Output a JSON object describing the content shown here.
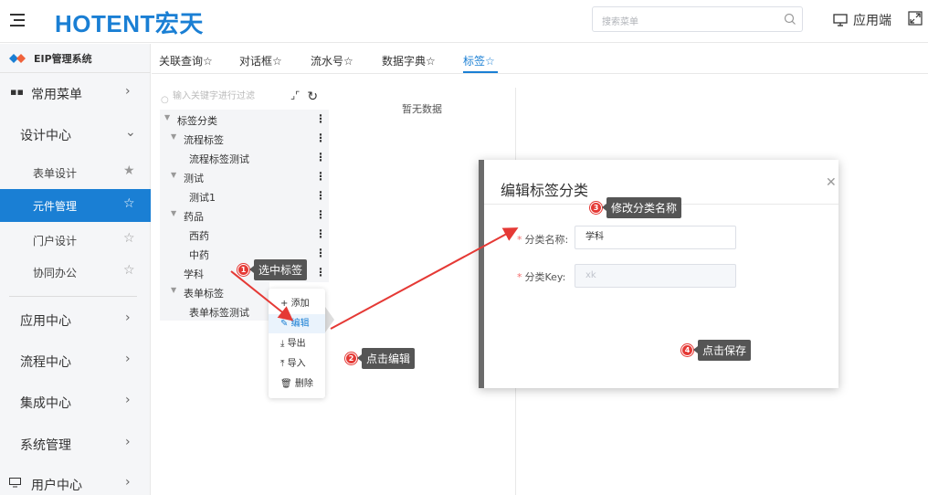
{
  "header": {
    "logo_text": "HOTENT宏天",
    "search_placeholder": "搜索菜单",
    "app_label": "应用端"
  },
  "sidebar": {
    "system_name": "EIP管理系统",
    "common_menu": "常用菜单",
    "design_center": "设计中心",
    "sub_items": [
      {
        "label": "表单设计",
        "active": false
      },
      {
        "label": "元件管理",
        "active": true
      },
      {
        "label": "门户设计",
        "active": false
      },
      {
        "label": "协同办公",
        "active": false
      }
    ],
    "groups": [
      "应用中心",
      "流程中心",
      "集成中心",
      "系统管理",
      "用户中心"
    ]
  },
  "tabs": [
    {
      "label": "关联查询☆",
      "active": false
    },
    {
      "label": "对话框☆",
      "active": false
    },
    {
      "label": "流水号☆",
      "active": false
    },
    {
      "label": "数据字典☆",
      "active": false
    },
    {
      "label": "标签☆",
      "active": true
    }
  ],
  "tree": {
    "filter_placeholder": "输入关键字进行过滤",
    "nodes": [
      {
        "label": "标签分类",
        "level": 0,
        "expanded": true
      },
      {
        "label": "流程标签",
        "level": 1,
        "expanded": true
      },
      {
        "label": "流程标签测试",
        "level": 2
      },
      {
        "label": "测试",
        "level": 1,
        "expanded": true
      },
      {
        "label": "测试1",
        "level": 2
      },
      {
        "label": "药品",
        "level": 1,
        "expanded": true
      },
      {
        "label": "西药",
        "level": 2
      },
      {
        "label": "中药",
        "level": 2
      },
      {
        "label": "学科",
        "level": 1
      },
      {
        "label": "表单标签",
        "level": 1,
        "expanded": true
      },
      {
        "label": "表单标签测试",
        "level": 2
      }
    ]
  },
  "context_menu": {
    "items": [
      {
        "label": "添加",
        "icon": "plus-icon"
      },
      {
        "label": "编辑",
        "icon": "edit-icon",
        "highlighted": true
      },
      {
        "label": "导出",
        "icon": "export-icon"
      },
      {
        "label": "导入",
        "icon": "import-icon"
      },
      {
        "label": "删除",
        "icon": "trash-icon"
      }
    ]
  },
  "empty_text": "暂无数据",
  "modal": {
    "title": "编辑标签分类",
    "name_label": "分类名称:",
    "name_value": "学科",
    "key_label": "分类Key:",
    "key_value": "xk"
  },
  "callouts": [
    {
      "num": "1",
      "text": "选中标签"
    },
    {
      "num": "2",
      "text": "点击编辑"
    },
    {
      "num": "3",
      "text": "修改分类名称"
    },
    {
      "num": "4",
      "text": "点击保存"
    }
  ],
  "colors": {
    "primary": "#1a7fd4",
    "callout_red": "#e53935",
    "arrow_red": "#e53935",
    "tag_bg": "#555555"
  }
}
